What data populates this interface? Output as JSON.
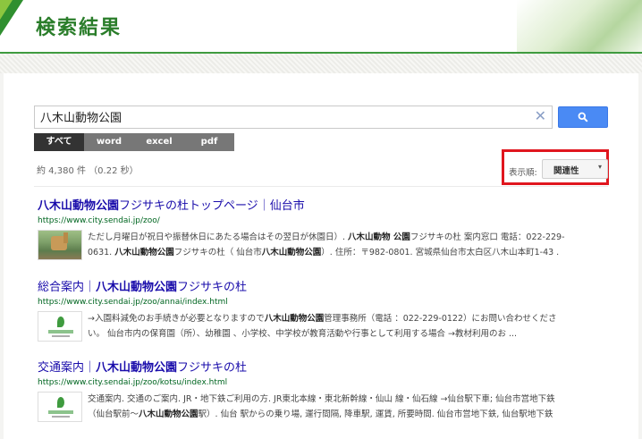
{
  "header": {
    "title": "検索結果"
  },
  "search": {
    "query": "八木山動物公園",
    "clear_glyph": "✕"
  },
  "tabs": [
    {
      "label": "すべて",
      "active": true
    },
    {
      "label": "word",
      "active": false
    },
    {
      "label": "excel",
      "active": false
    },
    {
      "label": "pdf",
      "active": false
    }
  ],
  "stats": {
    "count_text": "約 4,380 件 （0.22 秒）"
  },
  "sort": {
    "label": "表示順:",
    "value": "関連性"
  },
  "results": [
    {
      "title_bold": "八木山動物公園",
      "title_rest": "フジサキの杜トップページ｜仙台市",
      "url": "https://www.city.sendai.jp/zoo/",
      "thumb": "zoo-photo",
      "snippet_line1": [
        {
          "t": "ただし月曜日が祝日や振替休日にあたる場合はその翌日が休園日）. ",
          "b": false
        },
        {
          "t": "八木山動物 公園",
          "b": true
        },
        {
          "t": "フジサキの杜 案内窓口 電話：022-229-",
          "b": false
        }
      ],
      "snippet_line2": [
        {
          "t": "0631. ",
          "b": false
        },
        {
          "t": "八木山動物公園",
          "b": true
        },
        {
          "t": "フジサキの杜（ 仙台市",
          "b": false
        },
        {
          "t": "八木山動物公園",
          "b": true
        },
        {
          "t": "）. 住所：〒982-0801. 宮城県仙台市太白区八木山本町1-43 .",
          "b": false
        }
      ]
    },
    {
      "title_pre": "総合案内｜",
      "title_bold": "八木山動物公園",
      "title_rest": "フジサキの杜",
      "url": "https://www.city.sendai.jp/zoo/annai/index.html",
      "thumb": "sendai-logo",
      "snippet_line1": [
        {
          "t": "→入園料減免のお手続きが必要となりますので",
          "b": false
        },
        {
          "t": "八木山動物公園",
          "b": true
        },
        {
          "t": "管理事務所（電話 ：022-229-0122）にお問い合わせくださ",
          "b": false
        }
      ],
      "snippet_line2": [
        {
          "t": "い。 仙台市内の保育園（所）、幼稚園 、小学校、中学校が教育活動や行事として利用する場合 →教材利用のお ...",
          "b": false
        }
      ]
    },
    {
      "title_pre": "交通案内｜",
      "title_bold": "八木山動物公園",
      "title_rest": "フジサキの杜",
      "url": "https://www.city.sendai.jp/zoo/kotsu/index.html",
      "thumb": "sendai-logo",
      "snippet_line1": [
        {
          "t": "交通案内. 交通のご案内. JR・地下鉄ご利用の方. JR東北本線・東北新幹線・仙山 線・仙石線 →仙台駅下車; 仙台市営地下鉄",
          "b": false
        }
      ],
      "snippet_line2": [
        {
          "t": "（仙台駅前〜",
          "b": false
        },
        {
          "t": "八木山動物公園",
          "b": true
        },
        {
          "t": "駅）. 仙台 駅からの乗り場, 運行間隔, 降車駅, 運賃, 所要時間. 仙台市営地下鉄, 仙台駅地下鉄",
          "b": false
        }
      ]
    }
  ],
  "colors": {
    "accent_green": "#2a7d2a",
    "link_blue": "#1a0dab",
    "url_green": "#006621",
    "search_button": "#4a8af4",
    "highlight_red": "#e0161e"
  }
}
